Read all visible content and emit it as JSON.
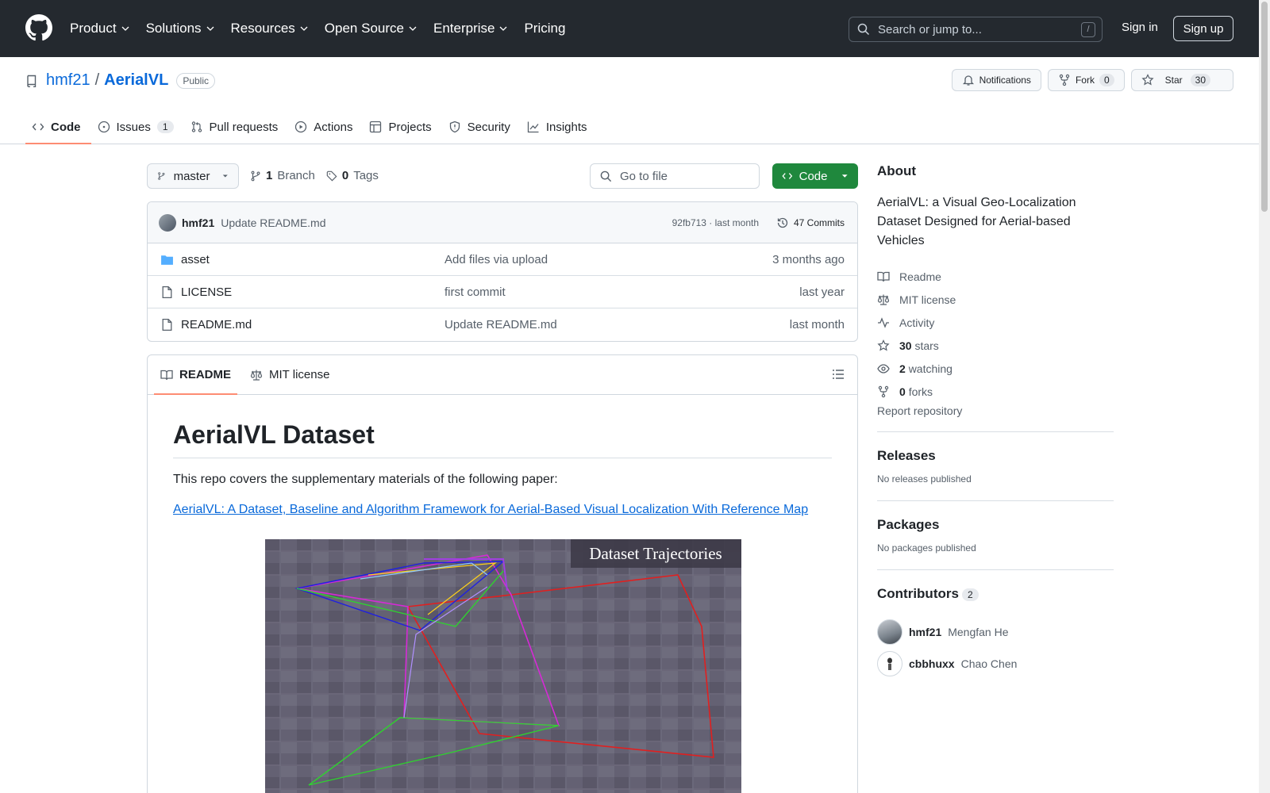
{
  "header": {
    "nav": [
      "Product",
      "Solutions",
      "Resources",
      "Open Source",
      "Enterprise",
      "Pricing"
    ],
    "search_placeholder": "Search or jump to...",
    "search_shortcut": "/",
    "sign_in": "Sign in",
    "sign_up": "Sign up"
  },
  "repo": {
    "owner": "hmf21",
    "separator": "/",
    "name": "AerialVL",
    "visibility": "Public",
    "notifications": "Notifications",
    "fork_label": "Fork",
    "fork_count": "0",
    "star_label": "Star",
    "star_count": "30"
  },
  "tabs": [
    {
      "label": "Code",
      "icon": "code-icon"
    },
    {
      "label": "Issues",
      "count": "1",
      "icon": "issue-icon"
    },
    {
      "label": "Pull requests",
      "icon": "pull-request-icon"
    },
    {
      "label": "Actions",
      "icon": "play-icon"
    },
    {
      "label": "Projects",
      "icon": "table-icon"
    },
    {
      "label": "Security",
      "icon": "shield-icon"
    },
    {
      "label": "Insights",
      "icon": "graph-icon"
    }
  ],
  "toolbar": {
    "branch": "master",
    "branch_count": "1",
    "branch_label": "Branch",
    "tag_count": "0",
    "tag_label": "Tags",
    "goto_placeholder": "Go to file",
    "code_button": "Code"
  },
  "commit": {
    "author": "hmf21",
    "message": "Update README.md",
    "meta": "92fb713 · last month",
    "commits": "47 Commits"
  },
  "files": [
    {
      "name": "asset",
      "type": "folder",
      "message": "Add files via upload",
      "time": "3 months ago"
    },
    {
      "name": "LICENSE",
      "type": "file",
      "message": "first commit",
      "time": "last year"
    },
    {
      "name": "README.md",
      "type": "file",
      "message": "Update README.md",
      "time": "last month"
    }
  ],
  "readme": {
    "tab_readme": "README",
    "tab_license": "MIT license",
    "title": "AerialVL Dataset",
    "intro": "This repo covers the supplementary materials of the following paper:",
    "paper_link": "AerialVL: A Dataset, Baseline and Algorithm Framework for Aerial-Based Visual Localization With Reference Map",
    "image_caption": "Dataset Trajectories"
  },
  "about": {
    "title": "About",
    "description": "AerialVL: a Visual Geo-Localization Dataset Designed for Aerial-based Vehicles",
    "readme": "Readme",
    "license": "MIT license",
    "activity": "Activity",
    "stars_count": "30",
    "stars_label": "stars",
    "watching_count": "2",
    "watching_label": "watching",
    "forks_count": "0",
    "forks_label": "forks",
    "report": "Report repository"
  },
  "releases": {
    "title": "Releases",
    "none": "No releases published"
  },
  "packages": {
    "title": "Packages",
    "none": "No packages published"
  },
  "contributors": {
    "title": "Contributors",
    "count": "2",
    "list": [
      {
        "login": "hmf21",
        "name": "Mengfan He"
      },
      {
        "login": "cbbhuxx",
        "name": "Chao Chen"
      }
    ]
  },
  "colors": {
    "header_bg": "#24292f",
    "link": "#0969da",
    "green": "#1f883d",
    "tab_underline": "#fd8c73"
  }
}
